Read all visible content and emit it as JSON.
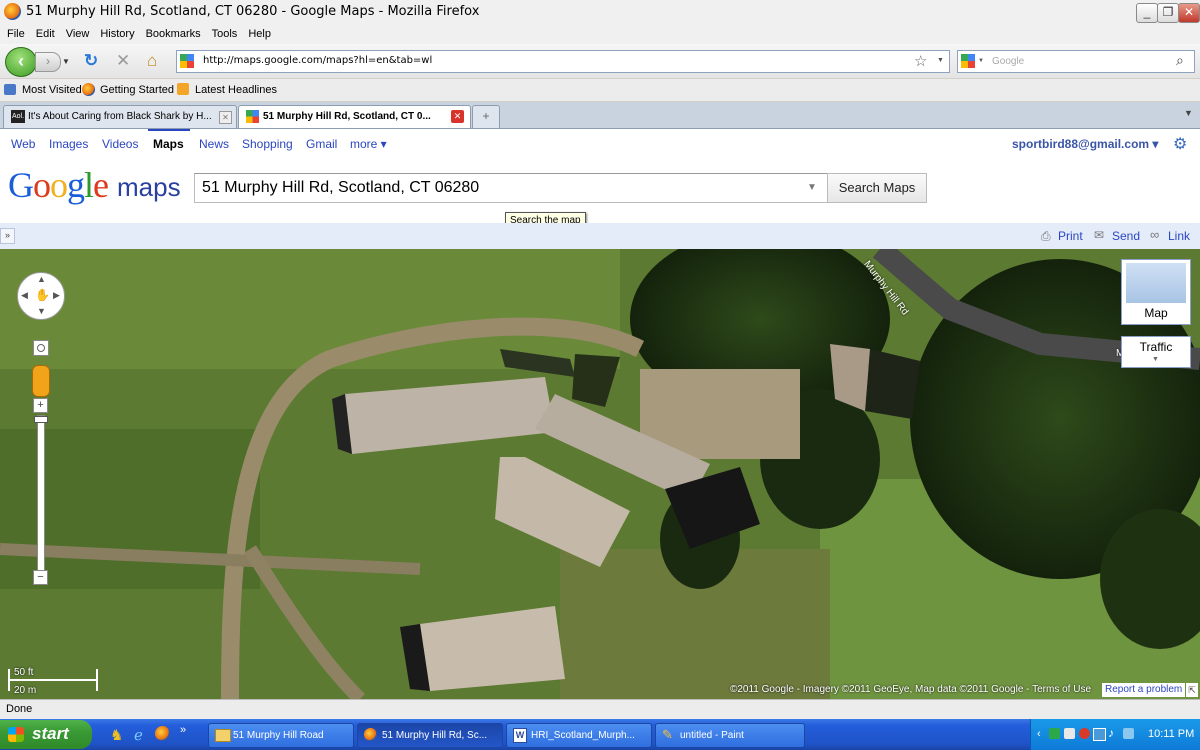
{
  "window": {
    "title": "51 Murphy Hill Rd, Scotland, CT 06280 - Google Maps - Mozilla Firefox",
    "controls": {
      "minimize": "_",
      "maximize": "❐",
      "close": "✕"
    }
  },
  "menu": [
    "File",
    "Edit",
    "View",
    "History",
    "Bookmarks",
    "Tools",
    "Help"
  ],
  "nav": {
    "url": "http://maps.google.com/maps?hl=en&tab=wl",
    "search_placeholder": "Google"
  },
  "bookmarks": [
    "Most Visited",
    "Getting Started",
    "Latest Headlines"
  ],
  "tabs": [
    {
      "label": "It's About Caring from Black Shark by H...",
      "active": false
    },
    {
      "label": "51 Murphy Hill Rd, Scotland, CT 0...",
      "active": true
    }
  ],
  "google_bar": {
    "links": [
      "Web",
      "Images",
      "Videos",
      "Maps",
      "News",
      "Shopping",
      "Gmail",
      "more ▾"
    ],
    "selected": "Maps",
    "account": "sportbird88@gmail.com ▾"
  },
  "header": {
    "logo_text": "Google",
    "logo_suffix": "maps",
    "search_value": "51 Murphy Hill Rd, Scotland, CT 06280",
    "search_button": "Search Maps",
    "tooltip": "Search the map"
  },
  "toolbar": {
    "expand": "»",
    "print": "Print",
    "send": "Send",
    "link": "Link"
  },
  "map": {
    "road_label": "Murphy Hill Rd",
    "road_label_secondary": "M",
    "map_type_button": "Map",
    "traffic_button": "Traffic",
    "zoom_in": "+",
    "zoom_out": "−",
    "scale_ft": "50 ft",
    "scale_m": "20 m",
    "copyright": "©2011 Google - Imagery ©2011 GeoEye, Map data ©2011 Google - Terms of Use",
    "report_problem": "Report a problem"
  },
  "status": "Done",
  "taskbar": {
    "start": "start",
    "items": [
      {
        "label": "51 Murphy Hill Road",
        "active": false
      },
      {
        "label": "51 Murphy Hill Rd, Sc...",
        "active": true
      },
      {
        "label": "HRI_Scotland_Murph...",
        "active": false
      },
      {
        "label": "untitled - Paint",
        "active": false
      }
    ],
    "clock": "10:11 PM"
  }
}
